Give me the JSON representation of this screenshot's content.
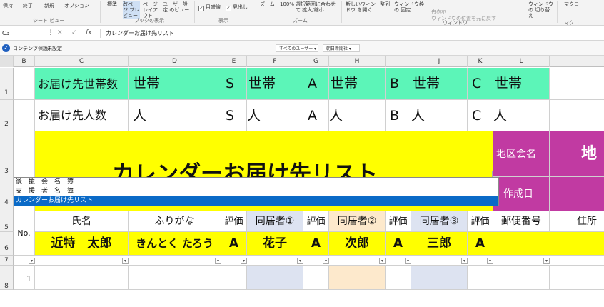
{
  "ribbon": {
    "view_group": {
      "label": "シート ビュー",
      "items": [
        "保持",
        "終了",
        "新規",
        "オプション"
      ]
    },
    "workbook_views": {
      "label": "ブックの表示",
      "items": [
        "標準",
        "改ページ プレビュー",
        "ページ レイアウト",
        "ユーザー設定 のビュー"
      ]
    },
    "show_group": {
      "label": "表示",
      "items": [
        "目盛線",
        "見出し"
      ]
    },
    "zoom_group": {
      "label": "ズーム",
      "items": [
        "ズーム",
        "100%",
        "選択範囲に合わせて 拡大/縮小"
      ]
    },
    "window_group": {
      "label": "ウィンドウ",
      "items": [
        "新しいウィンドウ を開く",
        "整列",
        "ウィンドウ枠の 固定",
        "再表示",
        "ウィンドウの位置を元に戻す"
      ]
    },
    "switch_window": "ウィンドウの 切り替え",
    "macro_group": {
      "label": "マクロ",
      "items": [
        "マクロ"
      ]
    }
  },
  "formula_bar": {
    "name_box": "C3",
    "fx": "fx",
    "formula": "カレンダーお届け先リスト"
  },
  "protection_bar": {
    "label": "コンテンツ保護:",
    "value": "未設定",
    "user_dropdown": "すべてのユーザー",
    "newspaper_dropdown": "朝日新聞社"
  },
  "columns": [
    "B",
    "C",
    "D",
    "E",
    "F",
    "G",
    "H",
    "I",
    "J",
    "K",
    "L"
  ],
  "rows": [
    "1",
    "2",
    "3",
    "4",
    "5",
    "6",
    "7",
    "8"
  ],
  "sheet": {
    "row1": {
      "label": "お届け先世帯数",
      "d": "世帯",
      "e": "S",
      "f": "世帯",
      "g": "A",
      "h": "世帯",
      "i": "B",
      "j": "世帯",
      "k": "C",
      "l": "世帯"
    },
    "row2": {
      "label": "お届け先人数",
      "d": "人",
      "e": "S",
      "f": "人",
      "g": "A",
      "h": "人",
      "i": "B",
      "j": "人",
      "k": "C",
      "l": "人"
    },
    "title": "カレンダーお届け先リスト",
    "area_label": "地区会名",
    "area_value": "地",
    "created_label": "作成日",
    "row5": {
      "no": "No.",
      "name": "氏名",
      "kana": "ふりがな",
      "eval1": "評価",
      "cohab1": "同居者①",
      "eval2": "評価",
      "cohab2": "同居者②",
      "eval3": "評価",
      "cohab3": "同居者③",
      "eval4": "評価",
      "zip": "郵便番号",
      "address": "住所"
    },
    "row6": {
      "name": "近特　太郎",
      "kana": "きんとく たろう",
      "eval1": "A",
      "cohab1": "花子",
      "eval2": "A",
      "cohab2": "次郎",
      "eval3": "A",
      "cohab3": "三郎",
      "eval4": "A"
    },
    "row8": {
      "no": "1"
    }
  },
  "autocomplete": [
    "後　援　会　名　簿",
    "支　援　者　名　簿",
    "カレンダーお届け先リスト"
  ],
  "colors": {
    "green": "#5cf5b8",
    "yellow": "#ffff00",
    "magenta": "#c13aa2",
    "blue_col": "#dde3f1",
    "peach_col": "#fde9cc",
    "selection": "#0a6ac7"
  }
}
